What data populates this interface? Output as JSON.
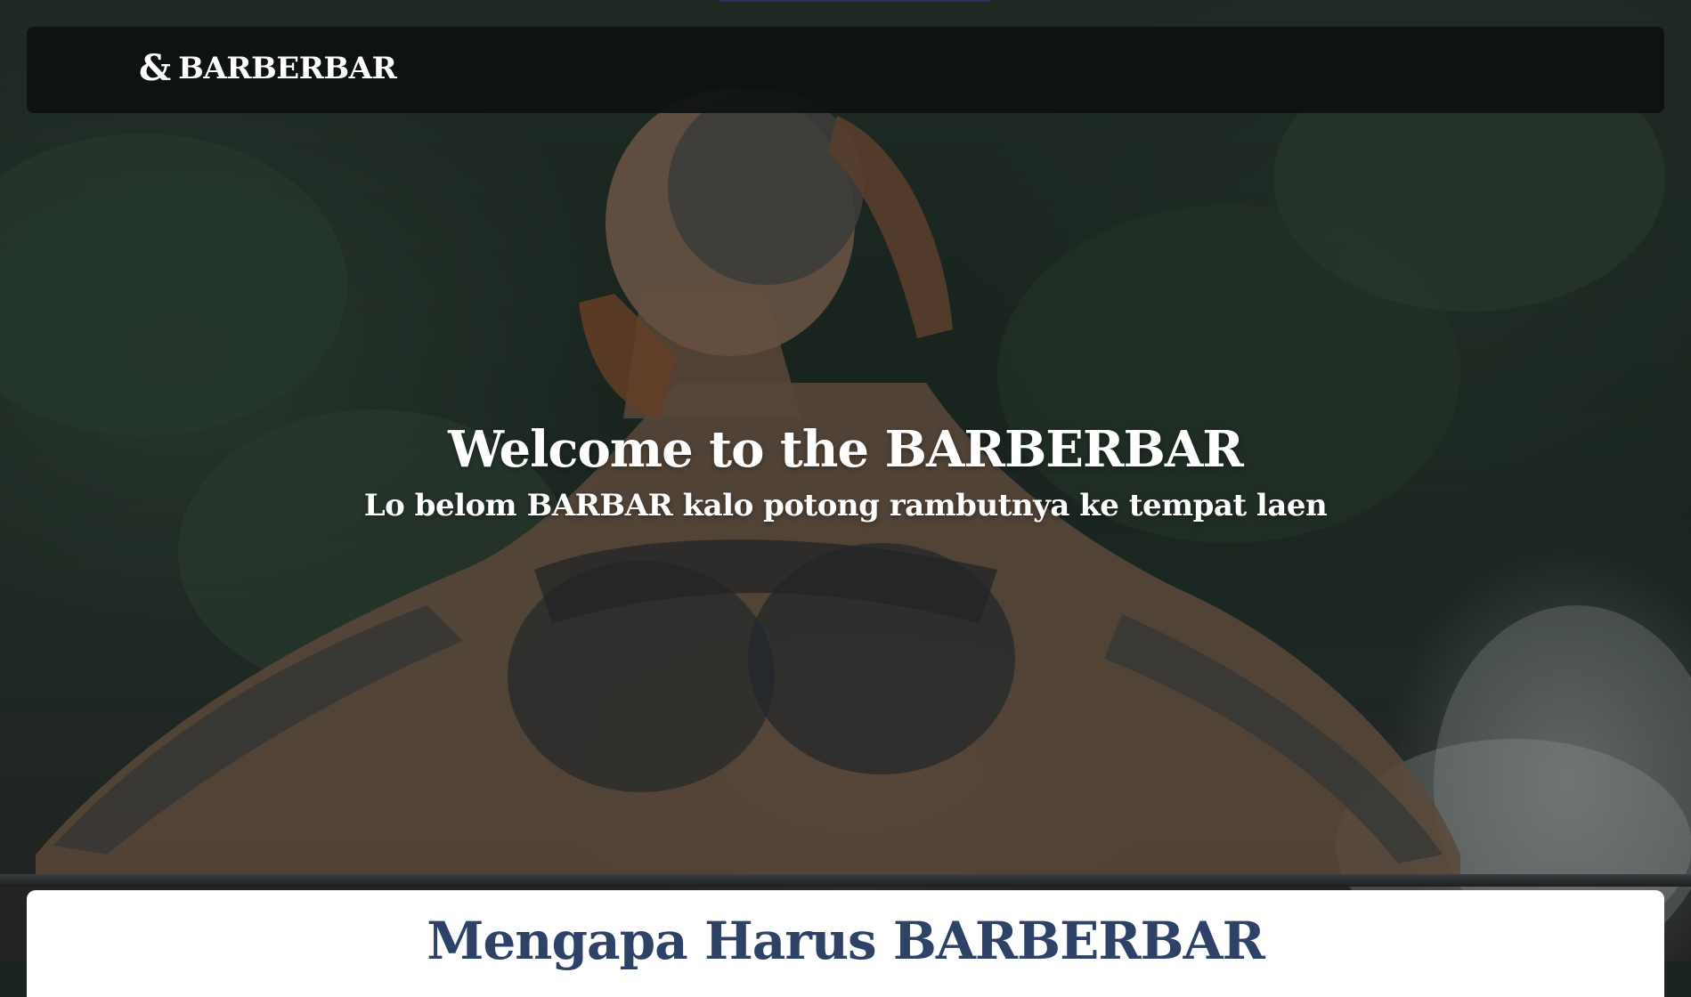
{
  "navbar": {
    "brand_icon": "&",
    "brand_name": "BARBERBAR"
  },
  "hero": {
    "title": "Welcome to the BARBERBAR",
    "subtitle": "Lo belom BARBAR kalo potong rambutnya ke tempat laen"
  },
  "section": {
    "title": "Mengapa Harus BARBERBAR"
  },
  "colors": {
    "navbar_bg": "#0c1110",
    "section_title": "#2e4166",
    "hero_text": "#ffffff"
  }
}
